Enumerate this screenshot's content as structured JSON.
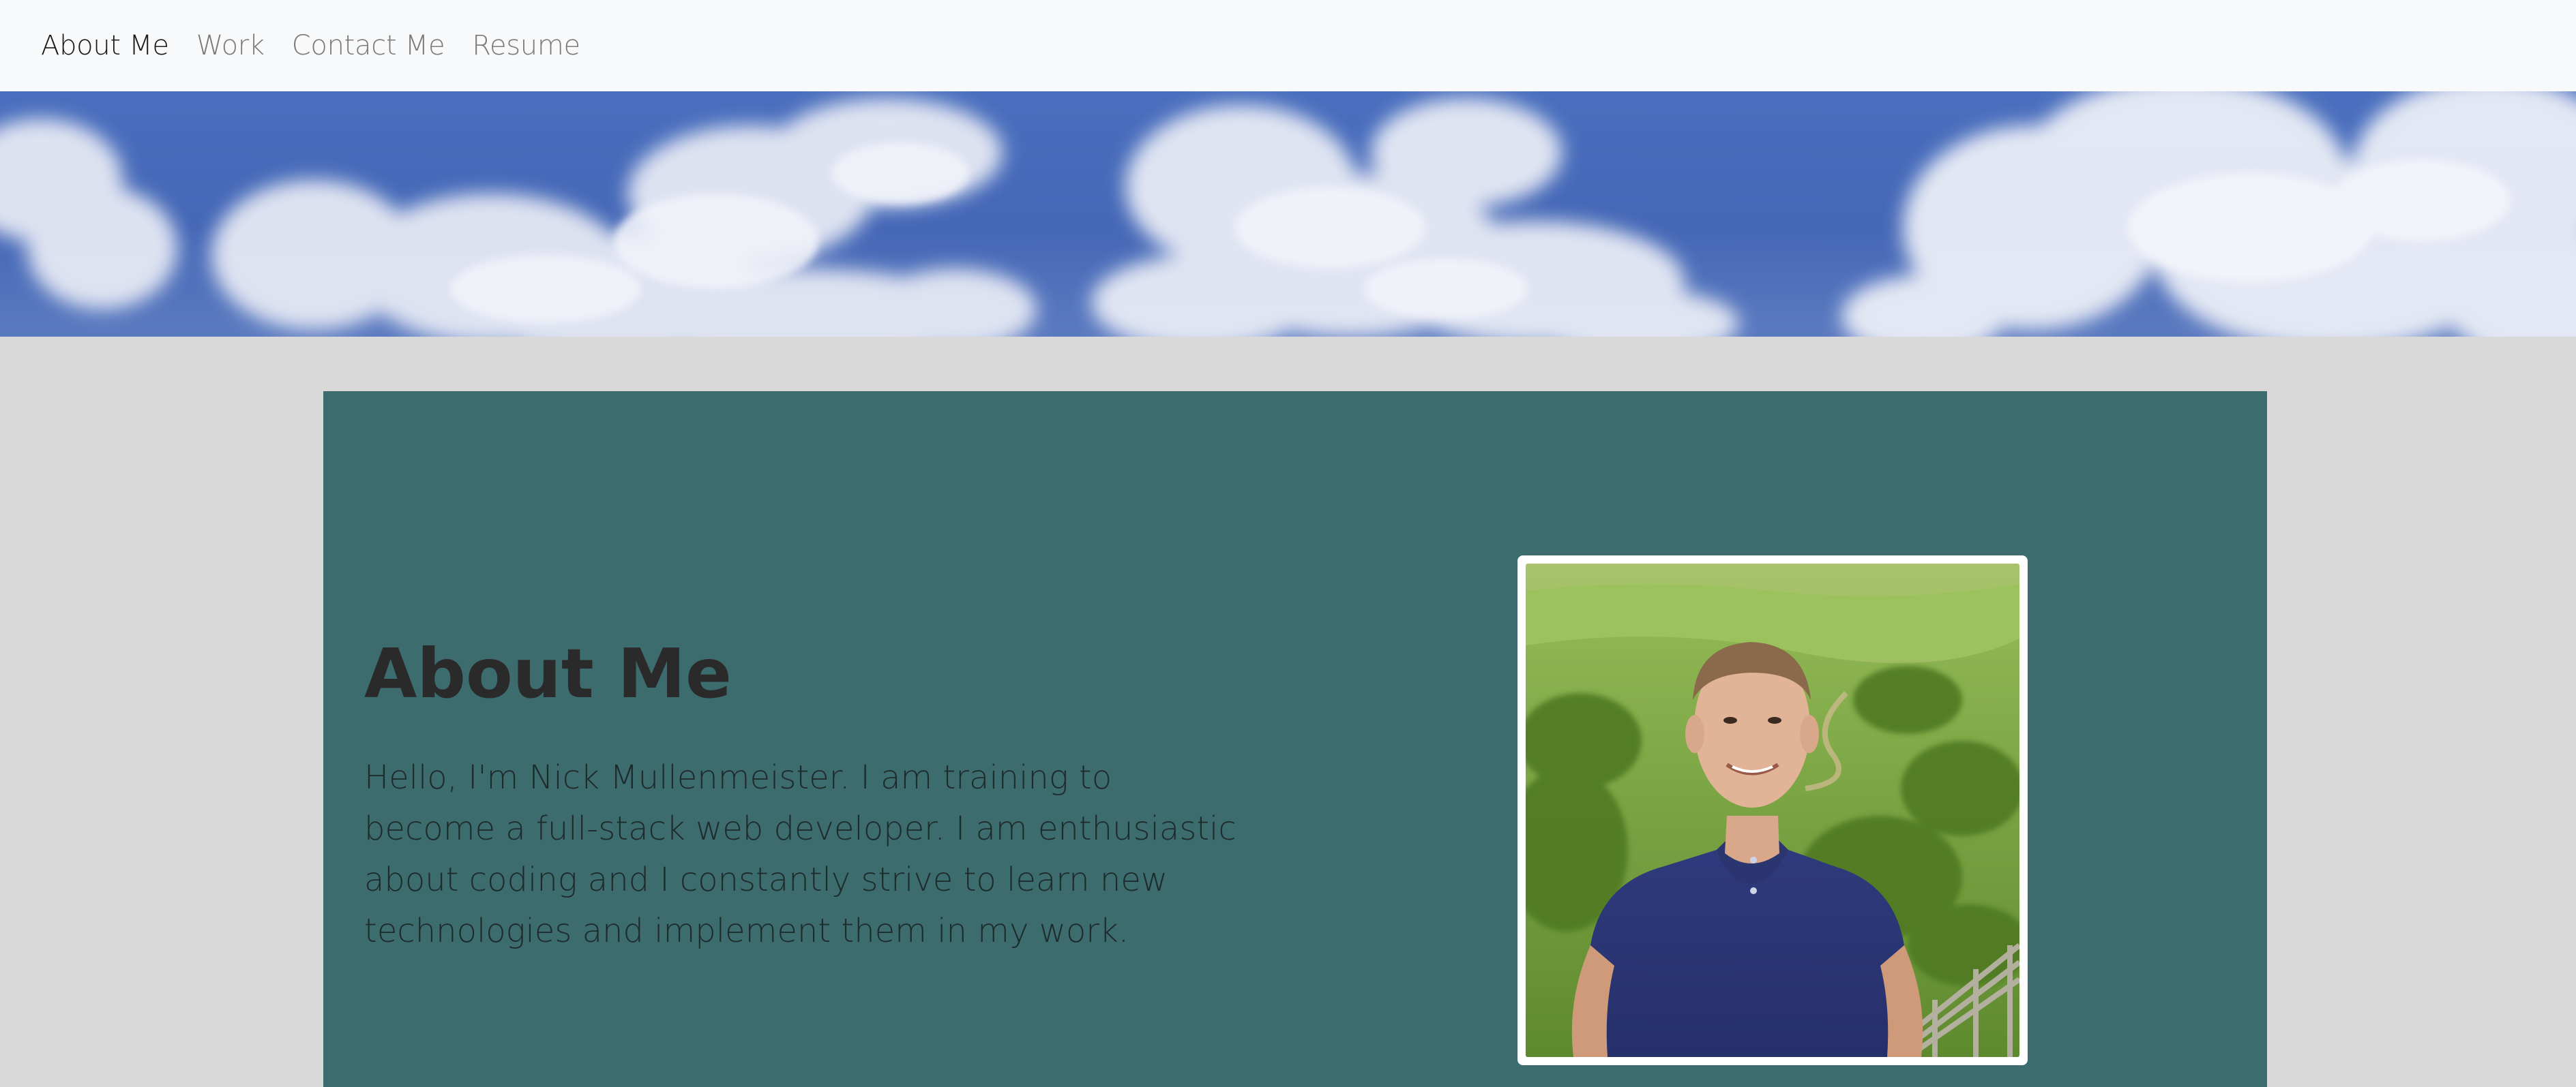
{
  "nav": {
    "items": [
      {
        "label": "About Me",
        "active": true
      },
      {
        "label": "Work",
        "active": false
      },
      {
        "label": "Contact Me",
        "active": false
      },
      {
        "label": "Resume",
        "active": false
      }
    ]
  },
  "about": {
    "title": "About Me",
    "text": "Hello, I'm Nick Mullenmeister. I am training to become a full-stack web developer. I am enthusiastic about coding and I constantly strive to learn new technologies and implement them in my work."
  },
  "colors": {
    "navbar_bg": "#f8f9fa",
    "page_bg": "#d9d9d9",
    "card_bg": "#3d6c6e",
    "sky_blue": "#4467b6",
    "active_nav": "#1a1a1a",
    "inactive_nav": "#7a7a7a"
  }
}
